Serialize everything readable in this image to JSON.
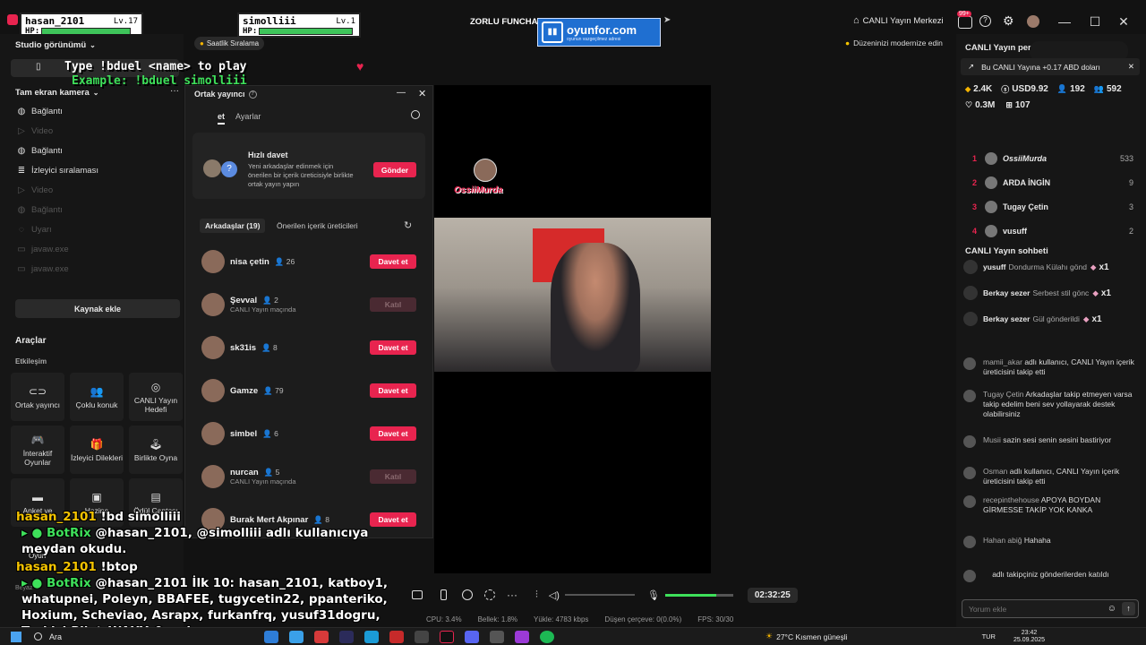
{
  "titlebar": {
    "player1": {
      "name": "hasan_2101",
      "level": "Lv.17",
      "hp_label": "HP:",
      "hp_fraction": 0.95
    },
    "player2": {
      "name": "simolliii",
      "level": "Lv.1",
      "hp_label": "HP:",
      "hp_fraction": 1.0
    },
    "title": "ZORLU FUNCHAL",
    "sponsor": "oyunfor.com",
    "sponsor_sub": "oyunun vazgeçilmez adresi",
    "live_center": "CANLI Yayın Merkezi",
    "notif_badge": "99+"
  },
  "left": {
    "studio_view": "Studio görünümü",
    "hourly_rank": "Saatlik Sıralama",
    "full_camera": "Tam ekran kamera",
    "items": [
      {
        "icon": "globe-icon",
        "label": "Bağlantı",
        "dim": false
      },
      {
        "icon": "play-icon",
        "label": "Video",
        "dim": true
      },
      {
        "icon": "globe-icon",
        "label": "Bağlantı",
        "dim": false
      },
      {
        "icon": "list-icon",
        "label": "İzleyici sıralaması",
        "dim": false
      },
      {
        "icon": "play-icon",
        "label": "Video",
        "dim": true
      },
      {
        "icon": "globe-icon",
        "label": "Bağlantı",
        "dim": true
      },
      {
        "icon": "bell-icon",
        "label": "Uyarı",
        "dim": true
      },
      {
        "icon": "file-icon",
        "label": "javaw.exe",
        "dim": true
      },
      {
        "icon": "file-icon",
        "label": "javaw.exe",
        "dim": true
      }
    ],
    "add_source": "Kaynak ekle",
    "tools_title": "Araçlar",
    "interaction": "Etkileşim",
    "tools": [
      {
        "icon": "link-icon",
        "label": "Ortak yayıncı"
      },
      {
        "icon": "users-icon",
        "label": "Çoklu konuk"
      },
      {
        "icon": "target-icon",
        "label": "CANLI Yayın Hedefi"
      },
      {
        "icon": "gamepad-icon",
        "label": "İnteraktif Oyunlar"
      },
      {
        "icon": "gift-icon",
        "label": "İzleyici Dilekleri"
      },
      {
        "icon": "joystick-icon",
        "label": "Birlikte Oyna"
      },
      {
        "icon": "poll-icon",
        "label": "Anket ve"
      },
      {
        "icon": "chest-icon",
        "label": "Hazine"
      },
      {
        "icon": "bag-icon",
        "label": "Ödül Çantası"
      }
    ],
    "game_label": "Oyun",
    "bottom_label": "Beyaz"
  },
  "overlay": {
    "bduel_line1": "Type !bduel <name> to play",
    "bduel_line2": "Example: !bduel simolliii",
    "tip": "Düzeninizi modernize edin"
  },
  "modal": {
    "title": "Ortak yayıncı",
    "tab_invite": "et",
    "tab_settings": "Ayarlar",
    "quick_invite_title": "Hızlı davet",
    "quick_invite_desc": "Yeni arkadaşlar edinmek için önerilen bir içerik üreticisiyle birlikte ortak yayın yapın",
    "send": "Gönder",
    "friends_tab": "Arkadaşlar (19)",
    "suggested_tab": "Önerilen içerik üreticileri",
    "friends": [
      {
        "name": "nisa çetin",
        "count": "26",
        "sub": "",
        "action": "Davet et",
        "enabled": true
      },
      {
        "name": "Şevval",
        "count": "2",
        "sub": "CANLI Yayın maçında",
        "action": "Katıl",
        "enabled": false
      },
      {
        "name": "sk31is",
        "count": "8",
        "sub": "",
        "action": "Davet et",
        "enabled": true
      },
      {
        "name": "Gamze",
        "count": "79",
        "sub": "",
        "action": "Davet et",
        "enabled": true
      },
      {
        "name": "simbel",
        "count": "6",
        "sub": "",
        "action": "Davet et",
        "enabled": true
      },
      {
        "name": "nurcan",
        "count": "5",
        "sub": "CANLI Yayın maçında",
        "action": "Katıl",
        "enabled": false
      },
      {
        "name": "Burak Mert Akpınar",
        "count": "8",
        "sub": "",
        "action": "Davet et",
        "enabled": true
      }
    ]
  },
  "preview": {
    "streamer_tag": "OssiiMurda"
  },
  "chat_overlay": [
    {
      "user": "hasan_2101",
      "text": "!bd simolliii",
      "bot": false
    },
    {
      "user": "BotRix",
      "text": "@hasan_2101, @simolliii adlı kullanıcıya meydan okudu.",
      "bot": true
    },
    {
      "user": "hasan_2101",
      "text": "!btop",
      "bot": false
    },
    {
      "user": "BotRix",
      "text": "@hasan_2101 İlk 10: hasan_2101, katboy1, whatupnei, Poleyn, BBAFEE, tugycetin22, ppanteriko, Hoxium, Scheviao, Asrapx, furkanfrq, yusuf31dogru, TurkishPilot_WAXY_0, yzbern.",
      "bot": true
    }
  ],
  "controls": {
    "timer": "02:32:25",
    "mic_level": 0.75
  },
  "status": {
    "cpu": "CPU: 3.4%",
    "memory": "Bellek: 1.8%",
    "upload": "Yükle: 4783 kbps",
    "dropped": "Düşen çerçeve: 0(0.0%)",
    "fps": "FPS: 30/30"
  },
  "right": {
    "live_pe": "CANLI Yayın per",
    "earning": "Bu CANLI Yayına +0.17 ABD doları",
    "stats": [
      {
        "icon": "diamond-icon",
        "value": "2.4K"
      },
      {
        "icon": "dollar-icon",
        "value": "USD9.92"
      },
      {
        "icon": "user-icon",
        "value": "192"
      },
      {
        "icon": "users-icon",
        "value": "592"
      },
      {
        "icon": "heart-icon",
        "value": "0.3M"
      },
      {
        "icon": "gift-icon",
        "value": "107"
      }
    ],
    "ranking": [
      {
        "rank": "1",
        "name": "OssiiMurda",
        "count": "533"
      },
      {
        "rank": "2",
        "name": "ARDA İNGİN",
        "count": "9"
      },
      {
        "rank": "3",
        "name": "Tugay Çetin",
        "count": "3"
      },
      {
        "rank": "4",
        "name": "vusuff",
        "count": "2"
      }
    ],
    "chat_title": "CANLI Yayın sohbeti",
    "gifts": [
      {
        "user": "yusuff",
        "text": "Dondurma Külahı gönd",
        "mult": "x1"
      },
      {
        "user": "Berkay sezer",
        "text": "Serbest stil gönc",
        "mult": "x1"
      },
      {
        "user": "Berkay sezer",
        "text": "Gül gönderildi",
        "mult": "x1"
      }
    ],
    "chat": [
      {
        "user": "mamii_akar",
        "text": "adlı kullanıcı, CANLI Yayın içerik üreticisini takip etti"
      },
      {
        "user": "Tugay Çetin",
        "badges": "No. 3",
        "text": "Arkadaşlar takip etmeyen varsa takip edelim beni sev yollayarak destek olabilirsiniz"
      },
      {
        "user": "Musii",
        "text": "sazin sesi senin sesini bastiriyor"
      },
      {
        "user": "Osman",
        "text": "adlı kullanıcı, CANLI Yayın içerik üreticisini takip etti"
      },
      {
        "user": "recepinthehouse",
        "text": "APOYA BOYDAN GİRMESSE TAKİP YOK KANKA"
      },
      {
        "user": "Hahan abiğ",
        "text": "Hahaha"
      },
      {
        "user": "ㅤ",
        "text": "adlı takipçiniz gönderilerden katıldı"
      }
    ],
    "comment_placeholder": "Yorum ekle"
  },
  "taskbar": {
    "search": "Ara",
    "weather": "27°C  Kısmen güneşli",
    "lang": "TUR",
    "time": "23:42",
    "date": "25.09.2025"
  }
}
